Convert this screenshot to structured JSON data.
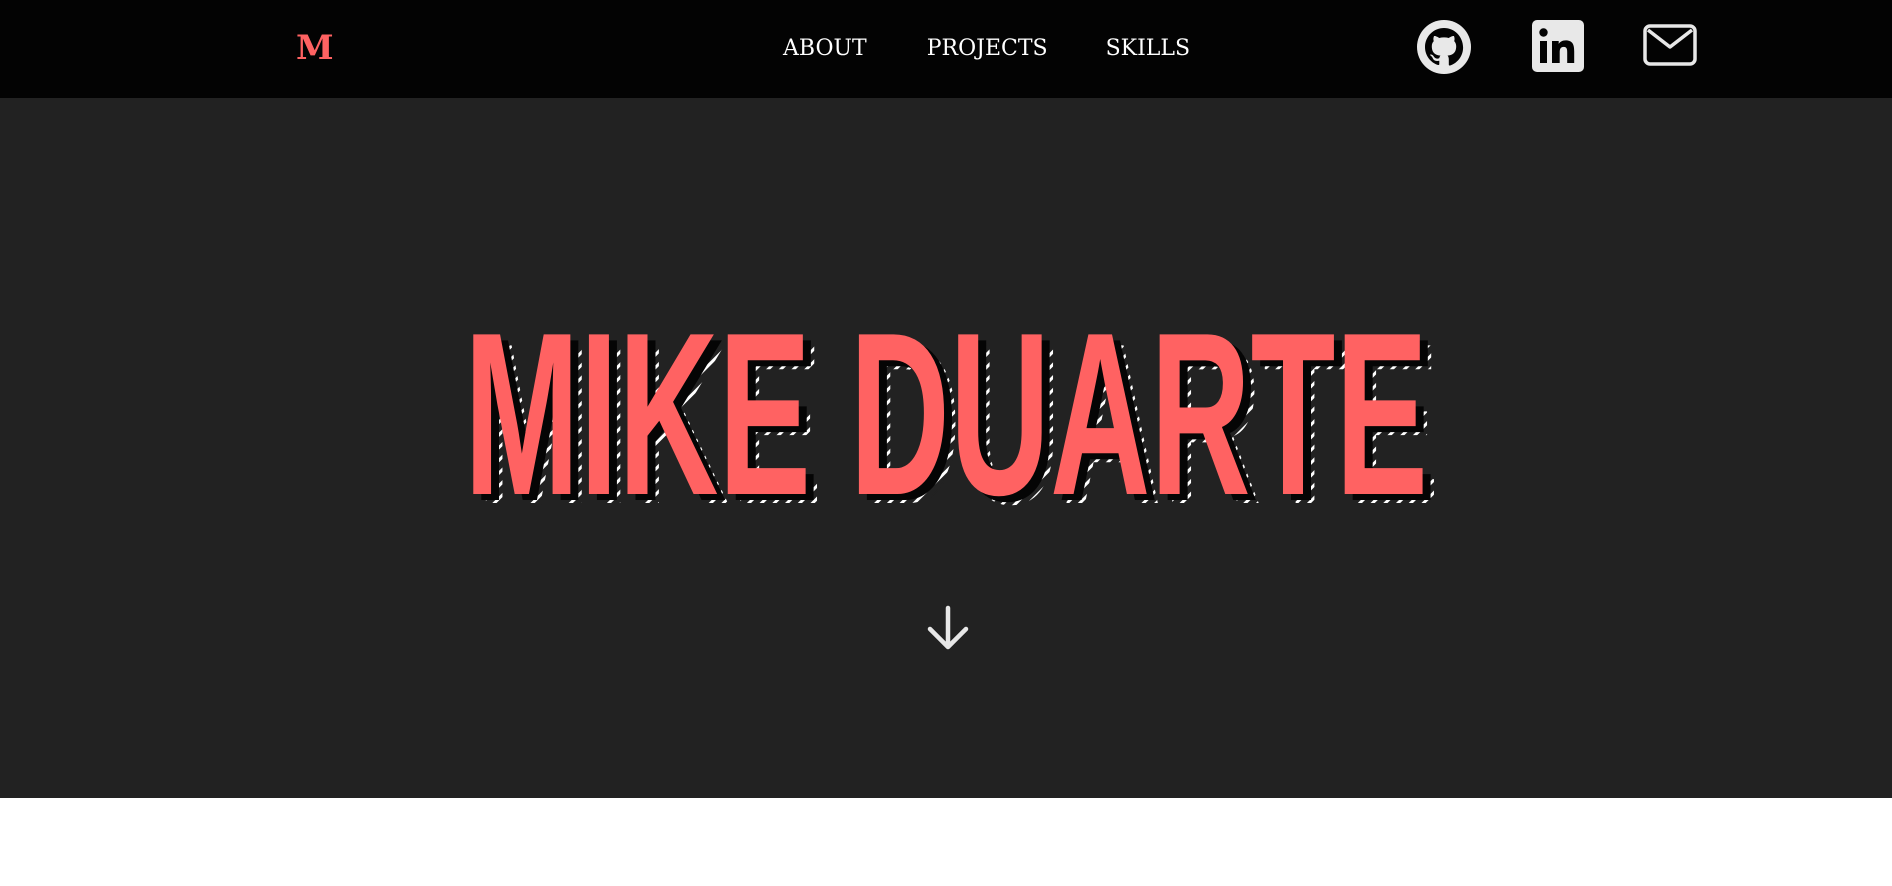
{
  "nav": {
    "logo": "M",
    "links": [
      {
        "label": "ABOUT"
      },
      {
        "label": "PROJECTS"
      },
      {
        "label": "SKILLS"
      }
    ],
    "social": [
      {
        "icon": "github-icon"
      },
      {
        "icon": "linkedin-icon"
      },
      {
        "icon": "mail-icon"
      }
    ]
  },
  "hero": {
    "title": "MIKE DUARTE",
    "scroll_icon": "arrow-down-icon"
  },
  "colors": {
    "accent": "#ff6262",
    "nav_bg": "#030303",
    "hero_bg": "#222222",
    "text": "#ffffff",
    "icon": "#e8e8e8"
  }
}
